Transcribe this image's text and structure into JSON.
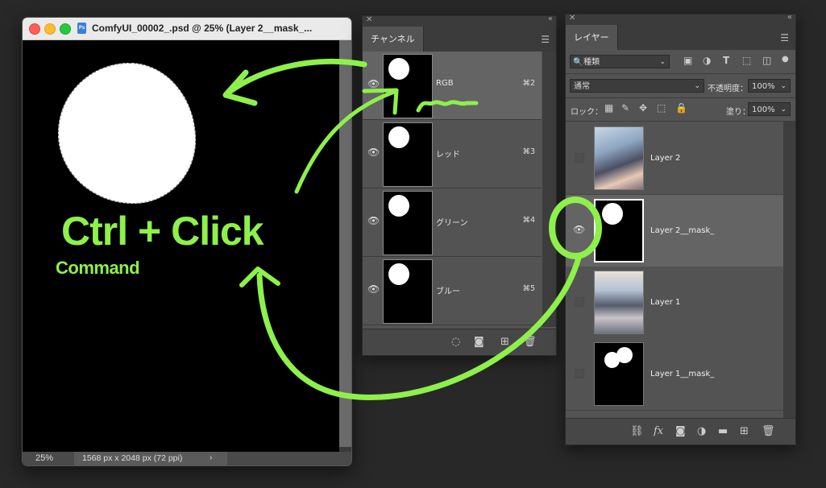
{
  "document": {
    "title": "ComfyUI_00002_.psd @ 25% (Layer 2__mask_...",
    "file_icon": "Ps",
    "zoom": "25%",
    "doc_size": "1568 px x 2048 px (72 ppi)",
    "arrow": "›"
  },
  "channels_panel": {
    "tab": "チャンネル",
    "channels": [
      {
        "name": "RGB",
        "shortcut": "⌘2"
      },
      {
        "name": "レッド",
        "shortcut": "⌘3"
      },
      {
        "name": "グリーン",
        "shortcut": "⌘4"
      },
      {
        "name": "ブルー",
        "shortcut": "⌘5"
      }
    ]
  },
  "layers_panel": {
    "tab": "レイヤー",
    "filter_kind": "種類",
    "blend_mode": "通常",
    "opacity_label": "不透明度：",
    "opacity_value": "100%",
    "lock_label": "ロック：",
    "fill_label": "塗り：",
    "fill_value": "100%",
    "layers": [
      {
        "name": "Layer 2",
        "visible": false,
        "selected": false
      },
      {
        "name": "Layer 2__mask_",
        "visible": true,
        "selected": true
      },
      {
        "name": "Layer 1",
        "visible": false,
        "selected": false
      },
      {
        "name": "Layer 1__mask_",
        "visible": false,
        "selected": false
      }
    ]
  },
  "annotation": {
    "main_text": "Ctrl + Click",
    "sub_text": "Command",
    "color": "#8ef04b"
  }
}
